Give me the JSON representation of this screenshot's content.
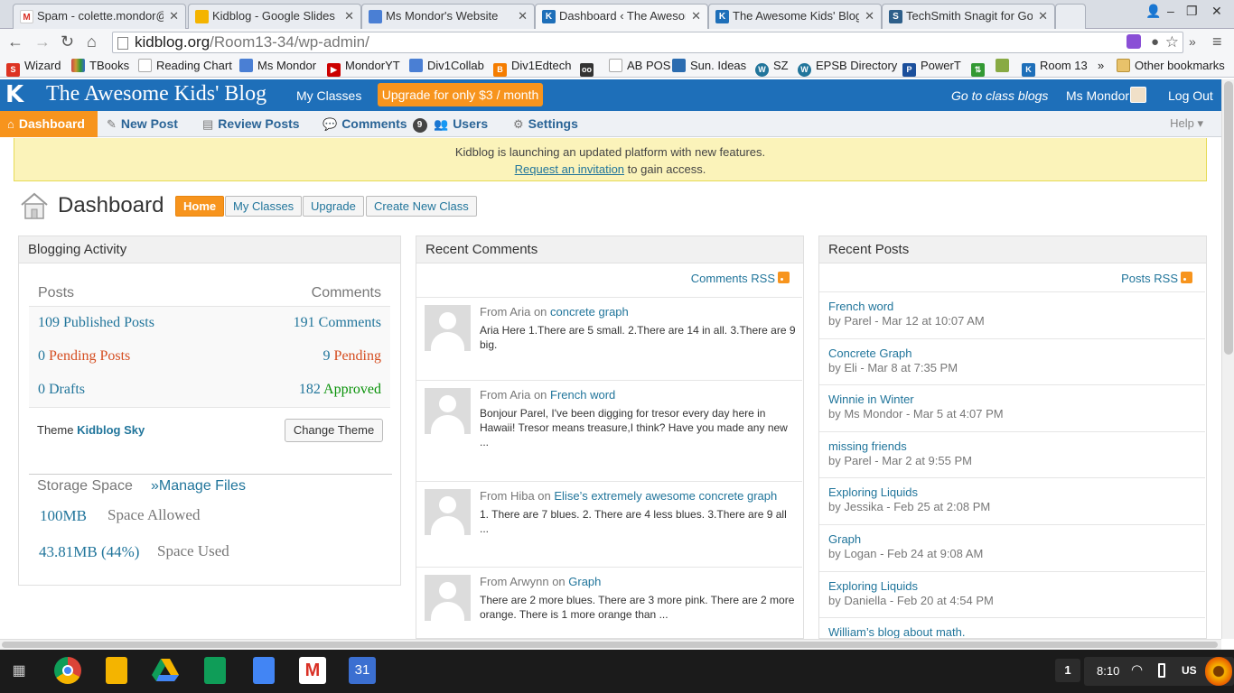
{
  "browser": {
    "tabs": [
      {
        "title": "Spam - colette.mondor@",
        "icon": "gmail-icon",
        "color": "#d93025",
        "glyph": "M"
      },
      {
        "title": "Kidblog - Google Slides",
        "icon": "slides-icon",
        "color": "#f4b400",
        "glyph": ""
      },
      {
        "title": "Ms Mondor's Website",
        "icon": "sites-icon",
        "color": "#4a7fd4",
        "glyph": ""
      },
      {
        "title": "Dashboard ‹ The Awesom",
        "icon": "kidblog-icon",
        "color": "#1e6fb9",
        "glyph": "K"
      },
      {
        "title": "The Awesome Kids' Blog",
        "icon": "kidblog-icon",
        "color": "#1e6fb9",
        "glyph": "K"
      },
      {
        "title": "TechSmith Snagit for Go",
        "icon": "snagit-icon",
        "color": "#2e5f8a",
        "glyph": "S"
      }
    ],
    "url_domain": "kidblog.org",
    "url_path": "/Room13-34/wp-admin/",
    "bookmarks": [
      {
        "label": "Wizard",
        "icon": "wizard-icon",
        "color": "#d32"
      },
      {
        "label": "TBooks",
        "icon": "tbooks-icon",
        "color": "#c44"
      },
      {
        "label": "Reading Chart",
        "icon": "page-icon",
        "color": "#aaa"
      },
      {
        "label": "Ms Mondor",
        "icon": "sites-icon",
        "color": "#4a7fd4"
      },
      {
        "label": "MondorYT",
        "icon": "youtube-icon",
        "color": "#c00"
      },
      {
        "label": "Div1Collab",
        "icon": "sites-icon",
        "color": "#4a7fd4"
      },
      {
        "label": "Div1Edtech",
        "icon": "blogger-icon",
        "color": "#f57d00"
      },
      {
        "label": "",
        "icon": "eyes-icon",
        "color": "#333"
      },
      {
        "label": "AB POS",
        "icon": "page-icon",
        "color": "#aaa"
      },
      {
        "label": "Sun. Ideas",
        "icon": "sun-ideas-icon",
        "color": "#2b6cb0"
      },
      {
        "label": "SZ",
        "icon": "wordpress-icon",
        "color": "#21759b"
      },
      {
        "label": "EPSB Directory",
        "icon": "wordpress-icon",
        "color": "#21759b"
      },
      {
        "label": "PowerT",
        "icon": "powerteacher-icon",
        "color": "#1b4f9c"
      },
      {
        "label": "",
        "icon": "updown-icon",
        "color": "#393"
      },
      {
        "label": "",
        "icon": "contact-icon",
        "color": "#8a4"
      },
      {
        "label": "Room 13",
        "icon": "kidblog-icon",
        "color": "#1e6fb9"
      }
    ],
    "bookmarks_overflow": "»",
    "other_bookmarks": "Other bookmarks"
  },
  "kidblog": {
    "title": "The Awesome Kids' Blog",
    "my_classes": "My Classes",
    "upgrade": "Upgrade for only $3 / month",
    "goto_class_blogs": "Go to class blogs",
    "user": "Ms Mondor",
    "logout": "Log Out"
  },
  "adminnav": {
    "dashboard": "Dashboard",
    "new_post": "New Post",
    "review_posts": "Review Posts",
    "comments": "Comments",
    "comments_count": "9",
    "users": "Users",
    "settings": "Settings",
    "help": "Help ▾"
  },
  "notice": {
    "line1": "Kidblog is launching an updated platform with new features.",
    "link": "Request an invitation",
    "line2_rest": " to gain access."
  },
  "dashboard": {
    "title": "Dashboard",
    "buttons": {
      "home": "Home",
      "my_classes": "My Classes",
      "upgrade": "Upgrade",
      "create": "Create New Class"
    }
  },
  "activity": {
    "header": "Blogging Activity",
    "col_posts": "Posts",
    "col_comments": "Comments",
    "rows": [
      {
        "left": "109 Published Posts",
        "right": "191 Comments"
      },
      {
        "left": "0 Pending Posts",
        "right": "9 Pending"
      },
      {
        "left": "0 Drafts",
        "right": "182 Approved"
      }
    ],
    "theme_label": "Theme ",
    "theme_name": "Kidblog Sky",
    "change_theme": "Change Theme",
    "storage_title": "Storage Space",
    "manage_files": "»Manage Files",
    "allowed_value": "100MB",
    "allowed_label": "Space Allowed",
    "used_value": "43.81MB (44%)",
    "used_label": "Space Used"
  },
  "comments": {
    "header": "Recent Comments",
    "rss": "Comments RSS",
    "items": [
      {
        "from": "From Aria",
        "post": "concrete graph",
        "body": "Aria Here 1.There are 5 small. 2.There are 14 in all. 3.There are 9 big."
      },
      {
        "from": "From Aria",
        "post": "French word",
        "body": "Bonjour Parel, I've been digging for tresor every day here in Hawaii! Tresor means treasure,I think? Have you made any new ..."
      },
      {
        "from": "From Hiba",
        "post": "Elise’s extremely awesome concrete graph",
        "body": "1. There are 7 blues. 2. There are 4 less blues. 3.There are 9 all ..."
      },
      {
        "from": "From Arwynn",
        "post": "Graph",
        "body": "There are 2 more blues. There are 3 more pink. There are 2 more orange. There is 1 more orange than ..."
      }
    ],
    "on_word": " on "
  },
  "posts": {
    "header": "Recent Posts",
    "rss": "Posts RSS",
    "items": [
      {
        "title": "French word",
        "meta": "by Parel - Mar 12 at 10:07 AM"
      },
      {
        "title": "Concrete Graph",
        "meta": "by Eli - Mar 8 at 7:35 PM"
      },
      {
        "title": "Winnie in Winter",
        "meta": "by Ms Mondor - Mar 5 at 4:07 PM"
      },
      {
        "title": "missing friends",
        "meta": "by Parel - Mar 2 at 9:55 PM"
      },
      {
        "title": "Exploring Liquids",
        "meta": "by Jessika - Feb 25 at 2:08 PM"
      },
      {
        "title": "Graph",
        "meta": "by Logan - Feb 24 at 9:08 AM"
      },
      {
        "title": "Exploring Liquids",
        "meta": "by Daniella - Feb 20 at 4:54 PM"
      },
      {
        "title": "William’s blog about math.",
        "meta": ""
      }
    ]
  },
  "shelf": {
    "apps": [
      "chrome-icon",
      "slides-icon",
      "drive-icon",
      "sheets-icon",
      "docs-icon",
      "gmail-icon",
      "calendar-icon"
    ],
    "calendar_day": "31",
    "notification_count": "1",
    "time": "8:10",
    "keyboard": "US"
  }
}
